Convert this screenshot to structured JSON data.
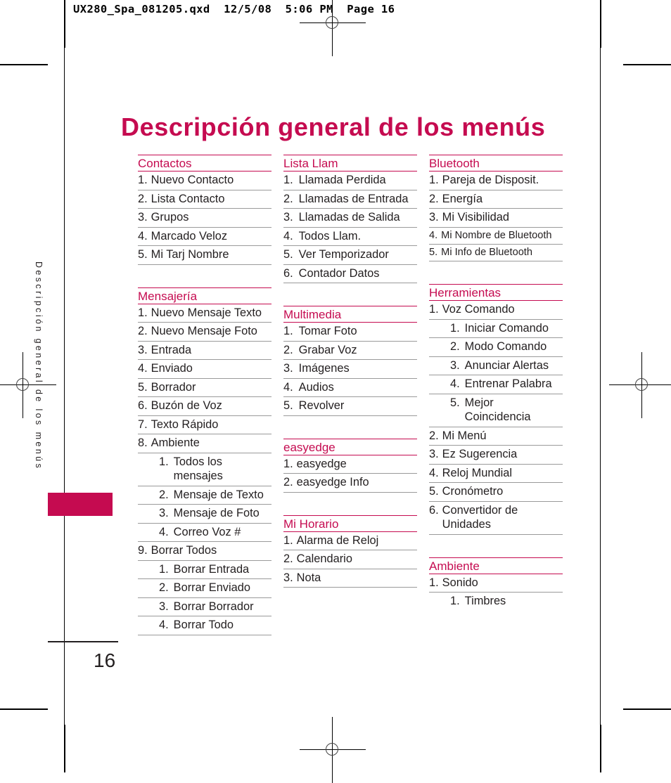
{
  "header_stamp": "UX280_Spa_081205.qxd  12/5/08  5:06 PM  Page 16",
  "title": "Descripción general de los menús",
  "sidebar": {
    "running_head": "Descripción general de los menús",
    "page_number": "16"
  },
  "colors": {
    "accent": "#c50b50",
    "text": "#231f20",
    "rule": "#9a9a9a"
  },
  "columns": [
    {
      "blocks": [
        {
          "heading": "Contactos",
          "items": [
            {
              "num": "1.",
              "label": "Nuevo Contacto",
              "level": 1
            },
            {
              "num": "2.",
              "label": "Lista Contacto",
              "level": 1
            },
            {
              "num": "3.",
              "label": "Grupos",
              "level": 1
            },
            {
              "num": "4.",
              "label": "Marcado Veloz",
              "level": 1
            },
            {
              "num": "5.",
              "label": "Mi Tarj Nombre",
              "level": 1
            }
          ]
        },
        {
          "heading": "Mensajería",
          "items": [
            {
              "num": "1.",
              "label": "Nuevo Mensaje Texto",
              "level": 1
            },
            {
              "num": "2.",
              "label": "Nuevo Mensaje Foto",
              "level": 1
            },
            {
              "num": "3.",
              "label": "Entrada",
              "level": 1
            },
            {
              "num": "4.",
              "label": "Enviado",
              "level": 1
            },
            {
              "num": "5.",
              "label": "Borrador",
              "level": 1
            },
            {
              "num": "6.",
              "label": "Buzón de Voz",
              "level": 1
            },
            {
              "num": "7.",
              "label": "Texto Rápido",
              "level": 1
            },
            {
              "num": "8.",
              "label": "Ambiente",
              "level": 1
            },
            {
              "num": "1.",
              "label": "Todos los mensajes",
              "level": 2
            },
            {
              "num": "2.",
              "label": "Mensaje de Texto",
              "level": 2
            },
            {
              "num": "3.",
              "label": "Mensaje de Foto",
              "level": 2
            },
            {
              "num": "4.",
              "label": "Correo Voz #",
              "level": 2
            },
            {
              "num": "9.",
              "label": "Borrar Todos",
              "level": 1
            },
            {
              "num": "1.",
              "label": "Borrar Entrada",
              "level": 2
            },
            {
              "num": "2.",
              "label": "Borrar Enviado",
              "level": 2
            },
            {
              "num": "3.",
              "label": "Borrar Borrador",
              "level": 2
            },
            {
              "num": "4.",
              "label": "Borrar Todo",
              "level": 2
            }
          ]
        }
      ]
    },
    {
      "blocks": [
        {
          "heading": "Lista Llam",
          "items": [
            {
              "num": "1.",
              "label": "Llamada Perdida",
              "level": 1,
              "wide_num": true
            },
            {
              "num": "2.",
              "label": "Llamadas de Entrada",
              "level": 1,
              "wide_num": true
            },
            {
              "num": "3.",
              "label": "Llamadas de Salida",
              "level": 1,
              "wide_num": true
            },
            {
              "num": "4.",
              "label": "Todos Llam.",
              "level": 1,
              "wide_num": true
            },
            {
              "num": "5.",
              "label": "Ver Temporizador",
              "level": 1,
              "wide_num": true
            },
            {
              "num": "6.",
              "label": "Contador Datos",
              "level": 1,
              "wide_num": true
            }
          ]
        },
        {
          "heading": "Multimedia",
          "items": [
            {
              "num": "1.",
              "label": "Tomar Foto",
              "level": 1,
              "wide_num": true
            },
            {
              "num": "2.",
              "label": "Grabar Voz",
              "level": 1,
              "wide_num": true
            },
            {
              "num": "3.",
              "label": "Imágenes",
              "level": 1,
              "wide_num": true
            },
            {
              "num": "4.",
              "label": "Audios",
              "level": 1,
              "wide_num": true
            },
            {
              "num": "5.",
              "label": "Revolver",
              "level": 1,
              "wide_num": true
            }
          ]
        },
        {
          "heading": "easyedge",
          "items": [
            {
              "num": "1.",
              "label": "easyedge",
              "level": 1
            },
            {
              "num": "2.",
              "label": "easyedge Info",
              "level": 1
            }
          ]
        },
        {
          "heading": "Mi Horario",
          "items": [
            {
              "num": "1.",
              "label": "Alarma de Reloj",
              "level": 1
            },
            {
              "num": "2.",
              "label": "Calendario",
              "level": 1
            },
            {
              "num": "3.",
              "label": "Nota",
              "level": 1
            }
          ]
        }
      ]
    },
    {
      "blocks": [
        {
          "heading": "Bluetooth",
          "items": [
            {
              "num": "1.",
              "label": "Pareja de Disposit.",
              "level": 1
            },
            {
              "num": "2.",
              "label": "Energía",
              "level": 1
            },
            {
              "num": "3.",
              "label": "Mi Visibilidad",
              "level": 1
            },
            {
              "num": "4.",
              "label": "Mi Nombre de Bluetooth",
              "level": 1,
              "narrow": true
            },
            {
              "num": "5.",
              "label": "Mi Info de Bluetooth",
              "level": 1,
              "narrow": true
            }
          ]
        },
        {
          "heading": "Herramientas",
          "items": [
            {
              "num": "1.",
              "label": "Voz Comando",
              "level": 1
            },
            {
              "num": "1.",
              "label": "Iniciar Comando",
              "level": 2
            },
            {
              "num": "2.",
              "label": "Modo Comando",
              "level": 2
            },
            {
              "num": "3.",
              "label": "Anunciar Alertas",
              "level": 2
            },
            {
              "num": "4.",
              "label": "Entrenar Palabra",
              "level": 2
            },
            {
              "num": "5.",
              "label": "Mejor\nCoincidencia",
              "level": 2
            },
            {
              "num": "2.",
              "label": "Mi Menú",
              "level": 1
            },
            {
              "num": "3.",
              "label": "Ez Sugerencia",
              "level": 1
            },
            {
              "num": "4.",
              "label": "Reloj Mundial",
              "level": 1
            },
            {
              "num": "5.",
              "label": "Cronómetro",
              "level": 1
            },
            {
              "num": "6.",
              "label": "Convertidor de\nUnidades",
              "level": 1
            }
          ]
        },
        {
          "heading": "Ambiente",
          "items": [
            {
              "num": "1.",
              "label": "Sonido",
              "level": 1
            },
            {
              "num": "1.",
              "label": "Timbres",
              "level": 2,
              "no_rule": true
            }
          ]
        }
      ]
    }
  ]
}
